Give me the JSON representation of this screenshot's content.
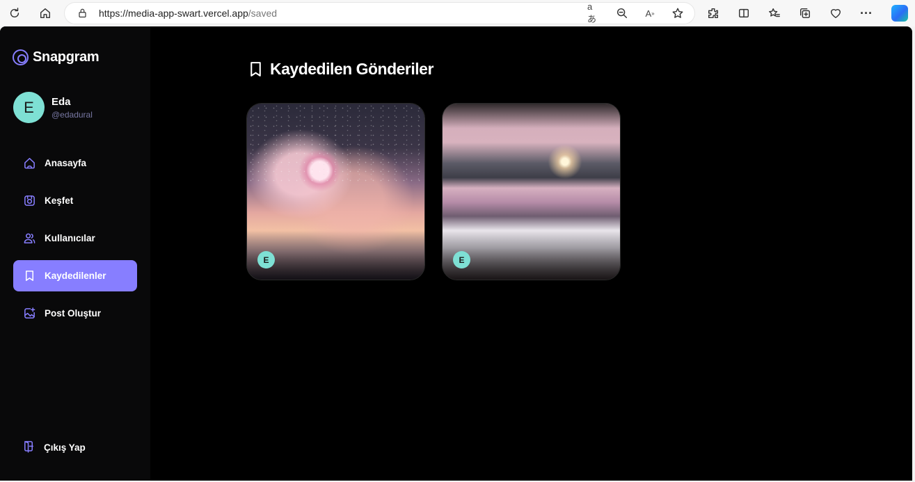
{
  "browser": {
    "url_host": "https://media-app-swart.vercel.app",
    "url_path": "/saved"
  },
  "app": {
    "name": "Snapgram",
    "accent_color": "#877eff"
  },
  "profile": {
    "initial": "E",
    "name": "Eda",
    "handle": "@edadural"
  },
  "sidebar": {
    "items": [
      {
        "label": "Anasayfa",
        "icon": "home-icon",
        "active": false
      },
      {
        "label": "Keşfet",
        "icon": "explore-icon",
        "active": false
      },
      {
        "label": "Kullanıcılar",
        "icon": "users-icon",
        "active": false
      },
      {
        "label": "Kaydedilenler",
        "icon": "bookmark-icon",
        "active": true
      },
      {
        "label": "Post Oluştur",
        "icon": "create-post-icon",
        "active": false
      }
    ],
    "logout_label": "Çıkış Yap"
  },
  "main": {
    "title": "Kaydedilen Gönderiler",
    "posts": [
      {
        "author_initial": "E",
        "image": "moon-clouds-image"
      },
      {
        "author_initial": "E",
        "image": "snowy-lake-image"
      }
    ]
  }
}
